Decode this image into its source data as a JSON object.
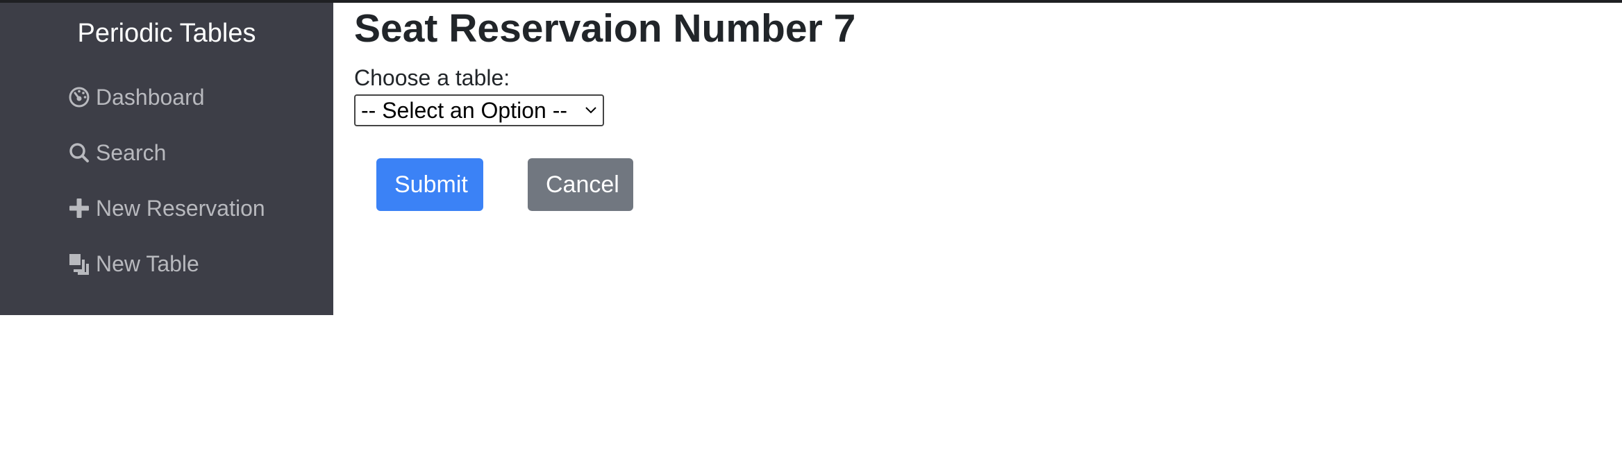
{
  "sidebar": {
    "brand": "Periodic Tables",
    "items": [
      {
        "label": "Dashboard",
        "icon": "dashboard-gauge-icon"
      },
      {
        "label": "Search",
        "icon": "search-icon"
      },
      {
        "label": "New Reservation",
        "icon": "plus-icon"
      },
      {
        "label": "New Table",
        "icon": "layers-icon"
      }
    ]
  },
  "main": {
    "title": "Seat Reservaion Number 7",
    "table_label": "Choose a table:",
    "table_select": {
      "selected": "-- Select an Option --"
    },
    "submit_label": "Submit",
    "cancel_label": "Cancel"
  },
  "colors": {
    "sidebar_bg": "#3d3e47",
    "primary": "#3b82f6",
    "secondary": "#717780"
  }
}
